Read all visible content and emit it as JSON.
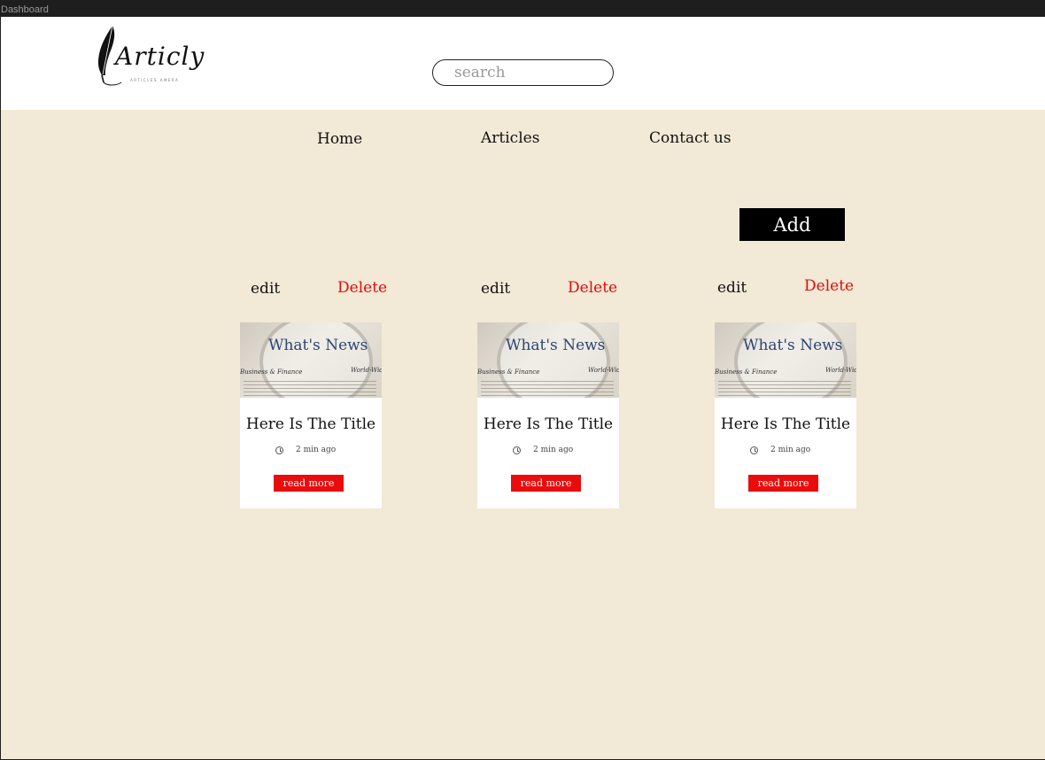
{
  "window": {
    "title": "Dashboard"
  },
  "logo": {
    "brand": "Articly",
    "tagline": "ARTICLES AMERA"
  },
  "search": {
    "placeholder": "search"
  },
  "nav": {
    "items": [
      "Home",
      "Articles",
      "Contact us"
    ]
  },
  "actions": {
    "add_label": "Add"
  },
  "cards": [
    {
      "edit": "edit",
      "delete": "Delete",
      "image_headline": "What's News",
      "image_section": "Business & Finance",
      "image_edition": "World-Wide",
      "title": "Here Is The Title",
      "time": "2 min ago",
      "read_more": "read more"
    },
    {
      "edit": "edit",
      "delete": "Delete",
      "image_headline": "What's News",
      "image_section": "Business & Finance",
      "image_edition": "World-Wide",
      "title": "Here Is The Title",
      "time": "2 min ago",
      "read_more": "read more"
    },
    {
      "edit": "edit",
      "delete": "Delete",
      "image_headline": "What's News",
      "image_section": "Business & Finance",
      "image_edition": "World-Wide",
      "title": "Here Is The Title",
      "time": "2 min ago",
      "read_more": "read more"
    }
  ],
  "colors": {
    "page_bg": "#f2e9d6",
    "header_bg": "#ffffff",
    "accent_red": "#ea0c0c",
    "button_black": "#000000"
  }
}
